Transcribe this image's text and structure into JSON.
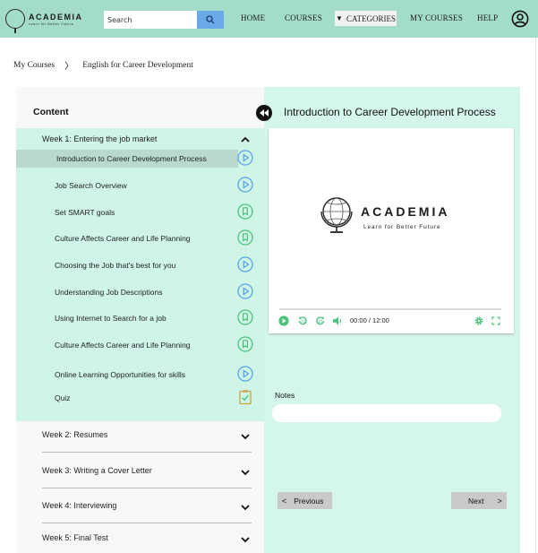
{
  "header": {
    "logo_name": "ACADEMIA",
    "logo_tagline": "Learn for Better Future",
    "search_placeholder": "Search",
    "nav": {
      "home": "HOME",
      "courses": "COURSES",
      "categories": "CATEGORIES",
      "my_courses": "MY COURSES",
      "help": "HELP"
    }
  },
  "breadcrumb": {
    "root": "My Courses",
    "separator": "〉",
    "current": "English for Career Development"
  },
  "sidebar": {
    "title": "Content",
    "week1": {
      "title": "Week 1: Entering the job market",
      "lessons": [
        {
          "label": "Introduction to Career Development Process",
          "icon": "play-circle-icon",
          "active": true
        },
        {
          "label": "Job Search Overview",
          "icon": "play-circle-icon"
        },
        {
          "label": "Set SMART goals",
          "icon": "reading-icon"
        },
        {
          "label": "Culture Affects Career and Life Planning",
          "icon": "reading-icon"
        },
        {
          "label": "Choosing the Job that's best for you",
          "icon": "play-circle-icon"
        },
        {
          "label": "Understanding Job Descriptions",
          "icon": "play-circle-icon"
        },
        {
          "label": "Using Internet to Search for a job",
          "icon": "reading-icon"
        },
        {
          "label": "Culture Affects Career and Life Planning",
          "icon": "reading-icon"
        },
        {
          "label": "Online Learning Opportunities for skills",
          "icon": "play-circle-icon"
        },
        {
          "label": "Quiz",
          "icon": "clipboard-check-icon"
        }
      ]
    },
    "weeks": [
      {
        "title": "Week 2: Resumes"
      },
      {
        "title": "Week 3: Writing a Cover Letter"
      },
      {
        "title": "Week 4: Interviewing"
      },
      {
        "title": "Week 5: Final Test"
      }
    ]
  },
  "main": {
    "title": "Introduction to Career Development Process",
    "video": {
      "logo_name": "ACADEMIA",
      "logo_tagline": "Learn for Better Future",
      "time": "00:00 / 12:00"
    },
    "notes_label": "Notes",
    "prev_label": "Previous",
    "next_label": "Next"
  },
  "colors": {
    "header_bg": "#a3dcc8",
    "panel_mint": "#cff5e6",
    "right_mint": "#d5f7ea",
    "active_row": "#b9d9cf",
    "play_blue": "#5aa4e6",
    "read_green": "#4cc27c",
    "search_btn": "#6aa9e8"
  }
}
